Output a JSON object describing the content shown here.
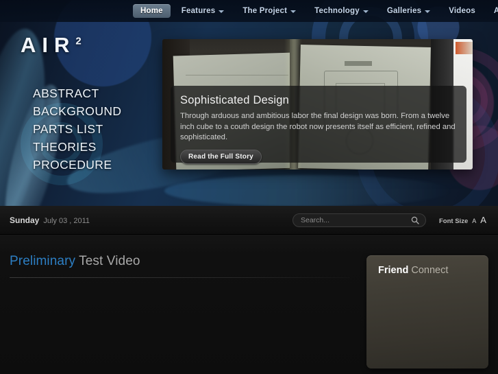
{
  "site": {
    "brand_text": "AIR",
    "brand_sup": "2"
  },
  "nav": {
    "items": [
      {
        "label": "Home",
        "active": true,
        "has_caret": false,
        "name": "nav-item-home"
      },
      {
        "label": "Features",
        "active": false,
        "has_caret": true,
        "name": "nav-item-features"
      },
      {
        "label": "The Project",
        "active": false,
        "has_caret": true,
        "name": "nav-item-the-project"
      },
      {
        "label": "Technology",
        "active": false,
        "has_caret": true,
        "name": "nav-item-technology"
      },
      {
        "label": "Galleries",
        "active": false,
        "has_caret": true,
        "name": "nav-item-galleries"
      },
      {
        "label": "Videos",
        "active": false,
        "has_caret": false,
        "name": "nav-item-videos"
      },
      {
        "label": "About Us",
        "active": false,
        "has_caret": true,
        "name": "nav-item-about-us"
      }
    ]
  },
  "hero_menu": {
    "items": [
      {
        "label": "ABSTRACT"
      },
      {
        "label": "BACKGROUND"
      },
      {
        "label": "PARTS LIST"
      },
      {
        "label": "THEORIES"
      },
      {
        "label": "PROCEDURE"
      }
    ]
  },
  "slider": {
    "caption_title": "Sophisticated Design",
    "caption_body": "Through arduous and ambitious labor the final design was born.  From a twelve inch cube to a couth design the robot now presents itself as efficient, refined and sophisticated.",
    "read_more_label": "Read the Full Story",
    "dots": [
      {
        "active": true
      },
      {
        "active": false
      },
      {
        "active": false
      }
    ]
  },
  "utility_bar": {
    "day_of_week": "Sunday",
    "date": "July 03 , 2011",
    "search_placeholder": "Search...",
    "search_value": "",
    "search_icon": "search-icon",
    "font_size_label": "Font Size",
    "font_size_small": "A",
    "font_size_large": "A"
  },
  "main": {
    "post_title_highlight": "Preliminary",
    "post_title_rest": " Test Video"
  },
  "sidebar_widget": {
    "title_bold": "Friend",
    "title_light": " Connect"
  },
  "colors": {
    "accent_blue": "#2d7fc4",
    "header_blue": "#16304f",
    "nav_active": "#5a6b7c",
    "widget_bg": "#403d35",
    "page_bg": "#0d0d0d"
  }
}
